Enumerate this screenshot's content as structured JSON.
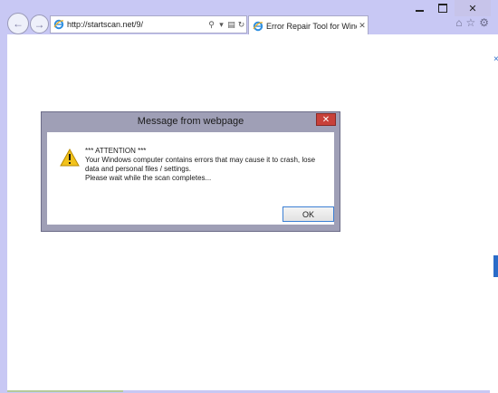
{
  "browser": {
    "address": {
      "url": "http://startscan.net/9/"
    },
    "tab": {
      "title": "Error Repair Tool for Windo..."
    }
  },
  "dialog": {
    "title": "Message from webpage",
    "lines": [
      "*** ATTENTION ***",
      "Your Windows computer contains errors that may cause it to crash, lose",
      "data and personal files / settings.",
      "Please wait while the scan completes..."
    ],
    "ok_label": "OK"
  },
  "icons": {
    "back": "back-arrow-icon",
    "forward": "forward-arrow-icon",
    "search": "search-icon",
    "compat": "compatibility-view-icon",
    "refresh": "refresh-icon",
    "home": "home-icon",
    "favorites": "star-icon",
    "tools": "gear-icon",
    "warning": "warning-icon"
  },
  "colors": {
    "frame": "#c8c8f4",
    "dialog_border": "#9f9fb6",
    "close_red": "#c8413a",
    "ok_border": "#3c7fd4"
  }
}
